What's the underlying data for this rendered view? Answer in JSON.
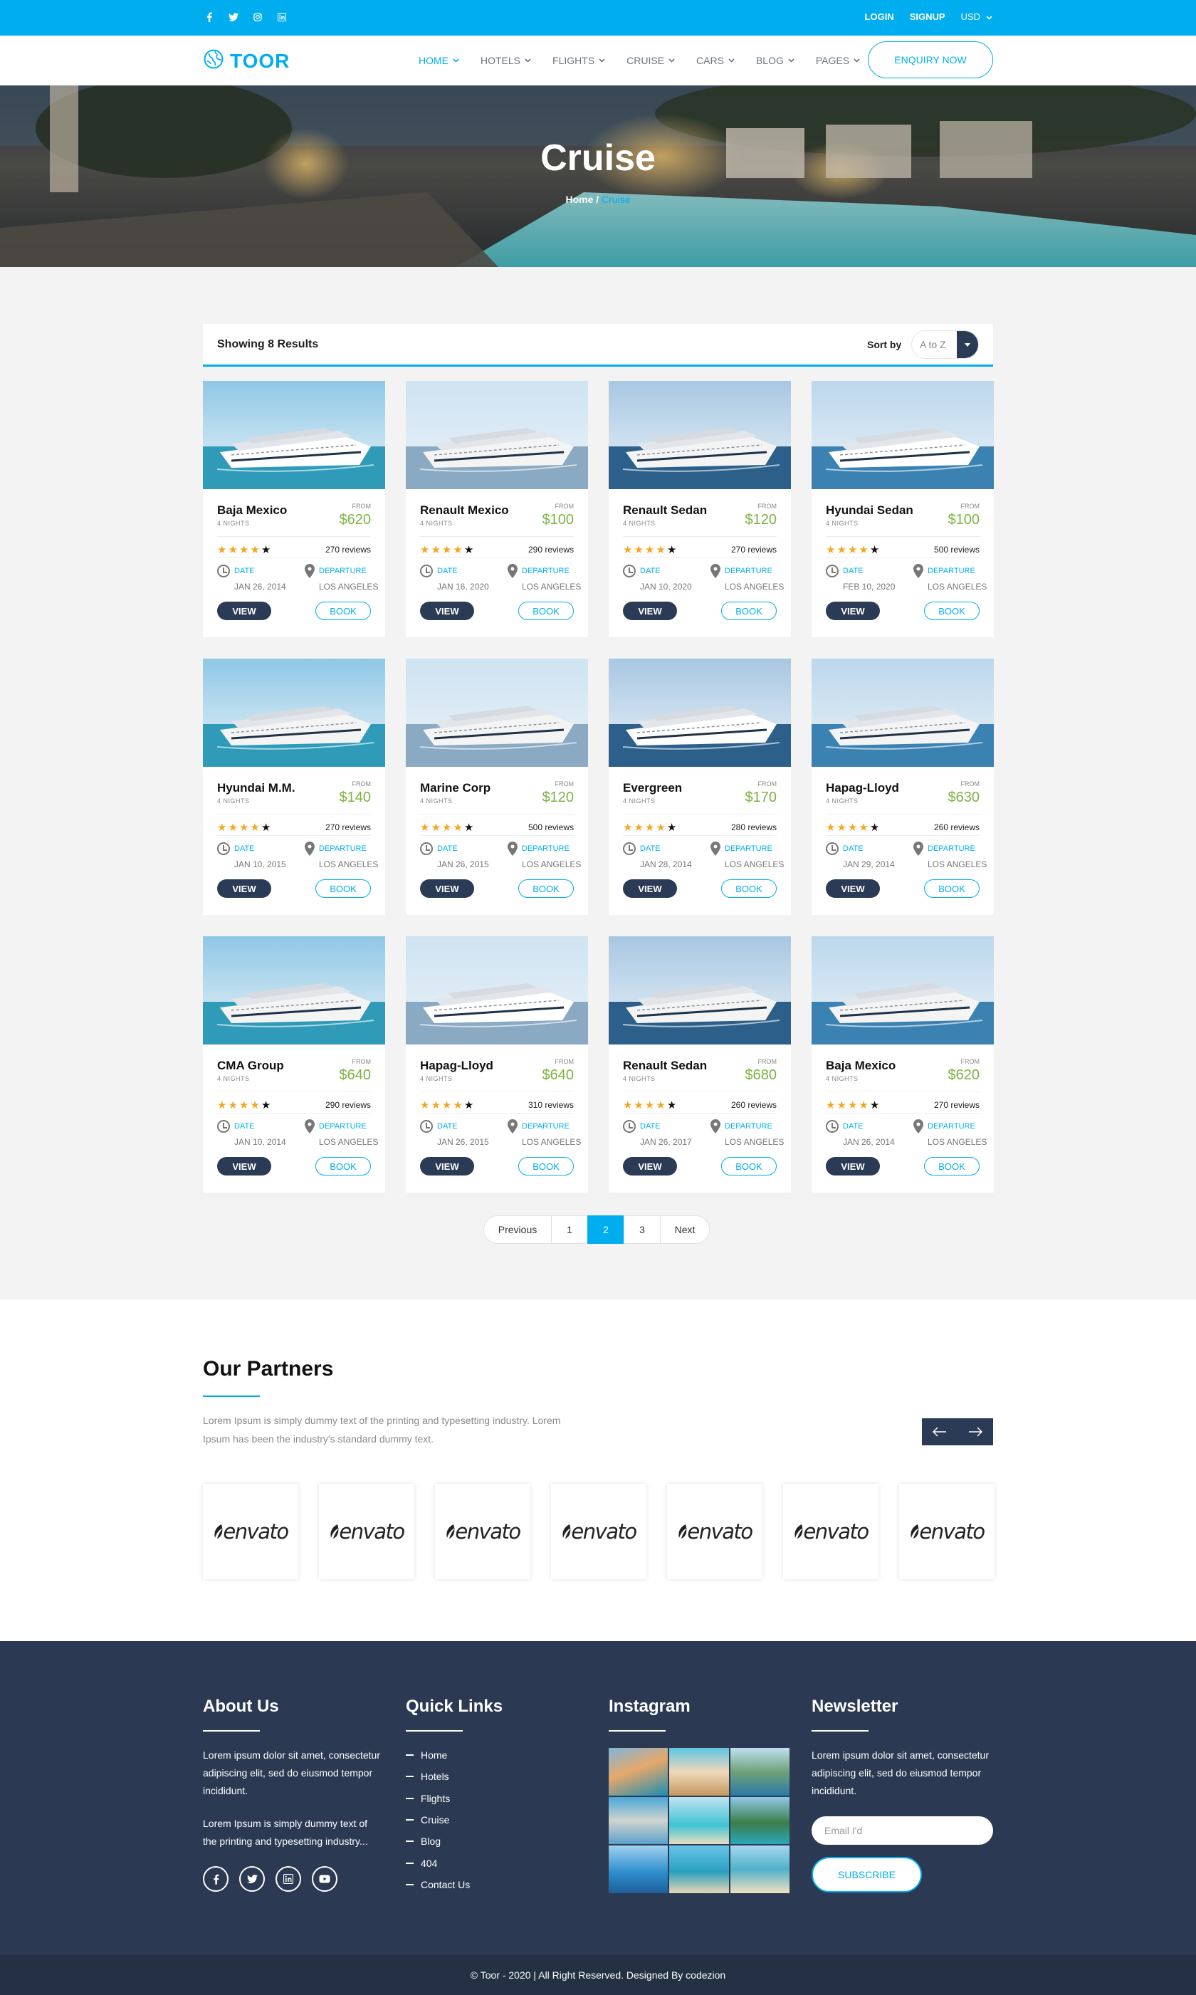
{
  "topbar": {
    "social_icons": [
      "facebook-icon",
      "twitter-icon",
      "instagram-icon",
      "linkedin-icon"
    ],
    "login": "LOGIN",
    "signup": "SIGNUP",
    "currency": "USD"
  },
  "brand": {
    "name": "TOOR",
    "accent": "#00aeef",
    "dark": "#2b3a55"
  },
  "nav": {
    "items": [
      {
        "label": "HOME"
      },
      {
        "label": "HOTELS"
      },
      {
        "label": "FLIGHTS"
      },
      {
        "label": "CRUISE"
      },
      {
        "label": "CARS"
      },
      {
        "label": "BLOG"
      },
      {
        "label": "PAGES"
      }
    ],
    "active": "HOME",
    "enquiry": "ENQUIRY NOW"
  },
  "hero": {
    "title": "Cruise",
    "breadcrumb_home": "Home",
    "breadcrumb_sep": "/",
    "breadcrumb_current": "Cruise"
  },
  "results": {
    "count_text": "Showing 8 Results",
    "sort_label": "Sort by",
    "sort_value": "A to Z"
  },
  "card_labels": {
    "from": "FROM",
    "date": "DATE",
    "departure": "DEPARTURE",
    "view": "VIEW",
    "book": "BOOK"
  },
  "cruises": [
    {
      "name": "Baja Mexico",
      "nights": "4 NIGHTS",
      "price": "$620",
      "rating": 4,
      "reviews": "270 reviews",
      "date": "JAN 26, 2014",
      "city": "LOS ANGELES"
    },
    {
      "name": "Renault Mexico",
      "nights": "4 NIGHTS",
      "price": "$100",
      "rating": 4,
      "reviews": "290 reviews",
      "date": "JAN 16, 2020",
      "city": "LOS ANGELES"
    },
    {
      "name": "Renault Sedan",
      "nights": "4 NIGHTS",
      "price": "$120",
      "rating": 4,
      "reviews": "270 reviews",
      "date": "JAN 10, 2020",
      "city": "LOS ANGELES"
    },
    {
      "name": "Hyundai Sedan",
      "nights": "4 NIGHTS",
      "price": "$100",
      "rating": 4,
      "reviews": "500 reviews",
      "date": "FEB 10, 2020",
      "city": "LOS ANGELES"
    },
    {
      "name": "Hyundai M.M.",
      "nights": "4 NIGHTS",
      "price": "$140",
      "rating": 4,
      "reviews": "270 reviews",
      "date": "JAN 10, 2015",
      "city": "LOS ANGELES"
    },
    {
      "name": "Marine Corp",
      "nights": "4 NIGHTS",
      "price": "$120",
      "rating": 4,
      "reviews": "500 reviews",
      "date": "JAN 26, 2015",
      "city": "LOS ANGELES"
    },
    {
      "name": "Evergreen",
      "nights": "4 NIGHTS",
      "price": "$170",
      "rating": 4,
      "reviews": "280 reviews",
      "date": "JAN 28, 2014",
      "city": "LOS ANGELES"
    },
    {
      "name": "Hapag-Lloyd",
      "nights": "4 NIGHTS",
      "price": "$630",
      "rating": 4,
      "reviews": "260 reviews",
      "date": "JAN 29, 2014",
      "city": "LOS ANGELES"
    },
    {
      "name": "CMA Group",
      "nights": "4 NIGHTS",
      "price": "$640",
      "rating": 4,
      "reviews": "290 reviews",
      "date": "JAN 10, 2014",
      "city": "LOS ANGELES"
    },
    {
      "name": "Hapag-Lloyd",
      "nights": "4 NIGHTS",
      "price": "$640",
      "rating": 4,
      "reviews": "310 reviews",
      "date": "JAN 26, 2015",
      "city": "LOS ANGELES"
    },
    {
      "name": "Renault Sedan",
      "nights": "4 NIGHTS",
      "price": "$680",
      "rating": 4,
      "reviews": "260 reviews",
      "date": "JAN 26, 2017",
      "city": "LOS ANGELES"
    },
    {
      "name": "Baja Mexico",
      "nights": "4 NIGHTS",
      "price": "$620",
      "rating": 4,
      "reviews": "270 reviews",
      "date": "JAN 26, 2014",
      "city": "LOS ANGELES"
    }
  ],
  "pagination": {
    "items": [
      "Previous",
      "1",
      "2",
      "3",
      "Next"
    ],
    "active": "2"
  },
  "partners": {
    "title": "Our Partners",
    "desc": "Lorem Ipsum is simply dummy text of the printing and typesetting industry. Lorem Ipsum has been the industry's standard dummy text.",
    "logos": [
      "envato",
      "envato",
      "envato",
      "envato",
      "envato",
      "envato",
      "envato"
    ]
  },
  "footer": {
    "about_title": "About Us",
    "about_p1": "Lorem ipsum dolor sit amet, consectetur adipiscing elit, sed do eiusmod tempor incididunt.",
    "about_p2": "Lorem Ipsum is simply dummy text of the printing and typesetting industry...",
    "social_icons": [
      "facebook-icon",
      "twitter-icon",
      "linkedin-icon",
      "youtube-icon"
    ],
    "links_title": "Quick Links",
    "links": [
      "Home",
      "Hotels",
      "Flights",
      "Cruise",
      "Blog",
      "404",
      "Contact Us"
    ],
    "insta_title": "Instagram",
    "news_title": "Newsletter",
    "news_text": "Lorem ipsum dolor sit amet, consectetur adipiscing elit, sed do eiusmod tempor incididunt.",
    "email_placeholder": "Email I'd",
    "subscribe": "SUBSCRIBE"
  },
  "copyright": "© Toor - 2020 | All Right Reserved. Designed By codezion"
}
